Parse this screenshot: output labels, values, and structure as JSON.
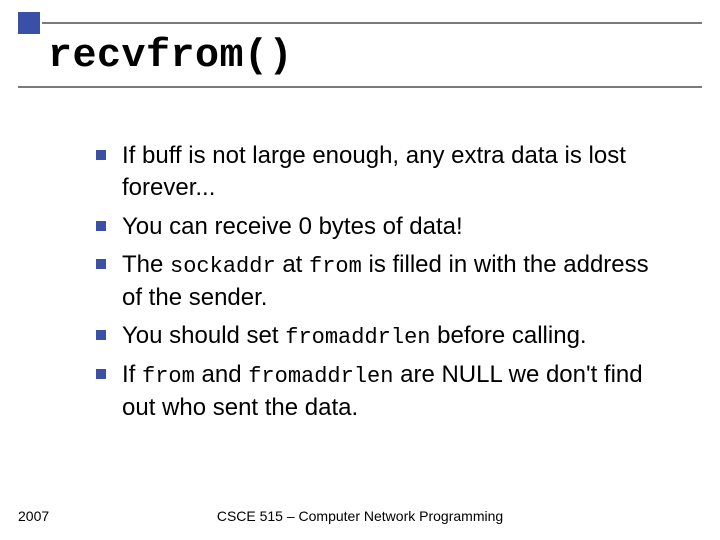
{
  "title": "recvfrom()",
  "bullets": [
    {
      "pre": "If buff is not large enough, any extra data is lost forever...",
      "code1": "",
      "mid": "",
      "code2": "",
      "post": ""
    },
    {
      "pre": "You can receive 0 bytes of data!",
      "code1": "",
      "mid": "",
      "code2": "",
      "post": ""
    },
    {
      "pre": "The ",
      "code1": "sockaddr",
      "mid": " at ",
      "code2": "from",
      "post": " is filled in with the address of the sender."
    },
    {
      "pre": "You should set ",
      "code1": "fromaddrlen",
      "mid": " before calling.",
      "code2": "",
      "post": ""
    },
    {
      "pre": "If ",
      "code1": "from",
      "mid": " and ",
      "code2": "fromaddrlen",
      "post": " are NULL we don't find out who sent the data."
    }
  ],
  "footer": {
    "year": "2007",
    "course": "CSCE 515 – Computer Network Programming"
  }
}
